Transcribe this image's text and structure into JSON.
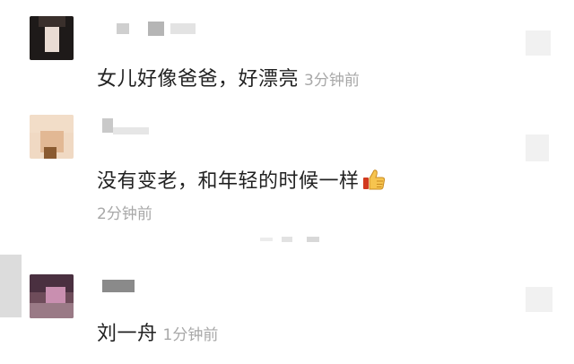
{
  "comments": [
    {
      "text": "女儿好像爸爸，好漂亮",
      "time": "3分钟前"
    },
    {
      "text": "没有变老，和年轻的时候一样",
      "time": "2分钟前",
      "emoji": "thumbs-up-icon"
    },
    {
      "text": "刘一舟",
      "time": "1分钟前"
    }
  ],
  "colors": {
    "text": "#222222",
    "time": "#a8a8a8",
    "background": "#ffffff"
  }
}
